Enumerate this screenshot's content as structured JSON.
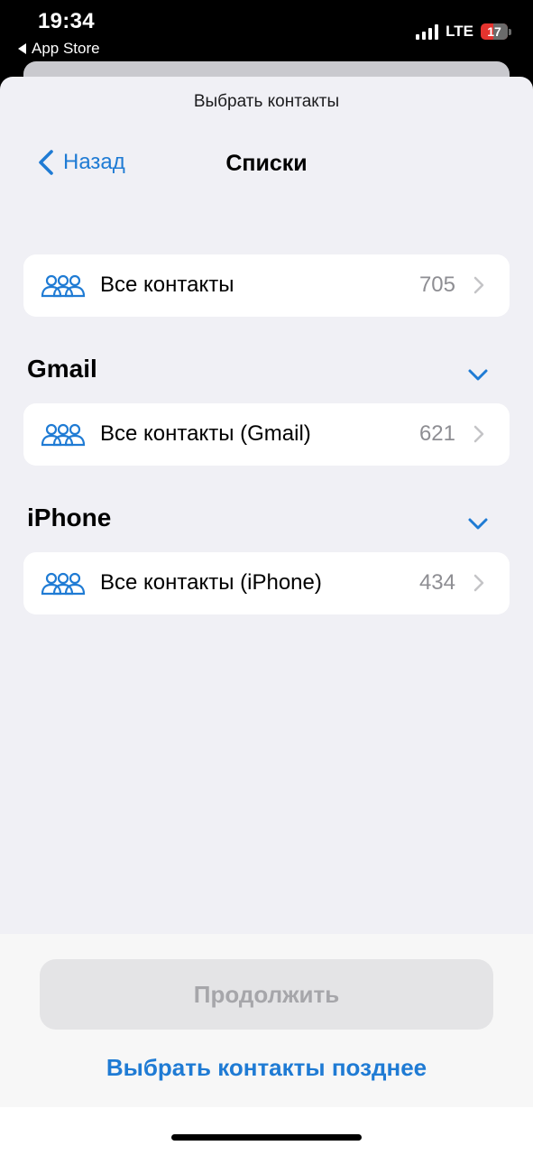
{
  "status_bar": {
    "time": "19:34",
    "back_app": "App Store",
    "network": "LTE",
    "battery_level": "17"
  },
  "sheet": {
    "title": "Выбрать контакты"
  },
  "nav": {
    "back_label": "Назад",
    "title": "Списки"
  },
  "lists": {
    "all": {
      "label": "Все контакты",
      "count": "705"
    }
  },
  "sections": [
    {
      "header": "Gmail",
      "item": {
        "label": "Все контакты (Gmail)",
        "count": "621"
      }
    },
    {
      "header": "iPhone",
      "item": {
        "label": "Все контакты (iPhone)",
        "count": "434"
      }
    }
  ],
  "footer": {
    "continue_label": "Продолжить",
    "later_label": "Выбрать контакты позднее"
  },
  "colors": {
    "accent": "#1f7bd4",
    "background": "#f0f0f5",
    "card": "#ffffff",
    "secondary_text": "#8e8e93",
    "disabled_button": "#e4e4e6",
    "battery_low": "#e5342f"
  },
  "icons": [
    "back-triangle-icon",
    "signal-icon",
    "battery-icon",
    "chevron-left-icon",
    "group-icon",
    "chevron-right-icon",
    "chevron-down-icon"
  ]
}
